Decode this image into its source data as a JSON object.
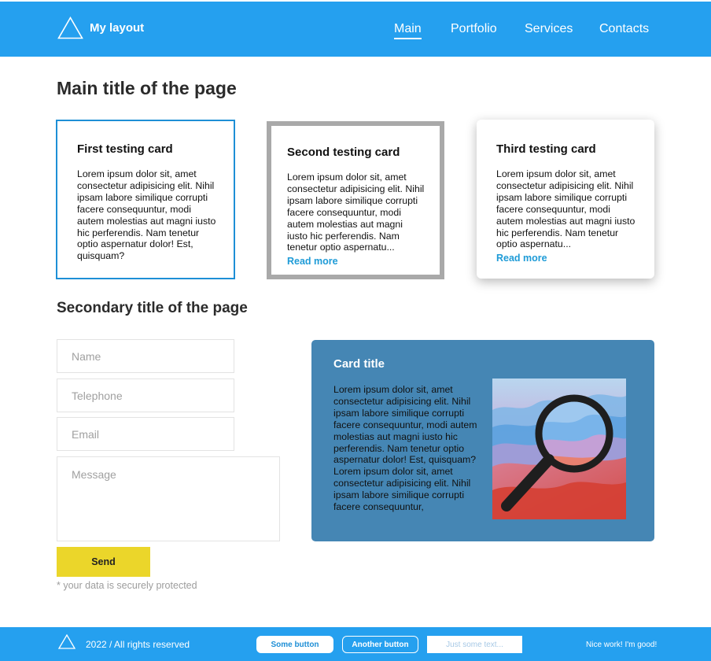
{
  "header": {
    "logo_text": "My layout",
    "nav": [
      "Main",
      "Portfolio",
      "Services",
      "Contacts"
    ],
    "active_nav": "Main"
  },
  "main_title": "Main title of the page",
  "cards": [
    {
      "title": "First testing card",
      "text": "Lorem ipsum dolor sit, amet consectetur adipisicing elit. Nihil ipsam labore similique corrupti facere consequuntur, modi autem molestias aut magni iusto hic perferendis. Nam tenetur optio aspernatur dolor! Est, quisquam?"
    },
    {
      "title": "Second testing card",
      "text": "Lorem ipsum dolor sit, amet consectetur adipisicing elit. Nihil ipsam labore similique corrupti facere consequuntur, modi autem molestias aut magni iusto hic perferendis. Nam tenetur optio aspernatu...",
      "link": "Read more"
    },
    {
      "title": "Third testing card",
      "text": "Lorem ipsum dolor sit, amet consectetur adipisicing elit. Nihil ipsam labore similique corrupti facere consequuntur, modi autem molestias aut magni iusto hic perferendis. Nam tenetur optio aspernatu...",
      "link": "Read more"
    }
  ],
  "secondary_title": "Secondary title of the page",
  "form": {
    "name_placeholder": "Name",
    "telephone_placeholder": "Telephone",
    "email_placeholder": "Email",
    "message_placeholder": "Message",
    "send_label": "Send",
    "note": "* your data is securely protected"
  },
  "feature_card": {
    "title": "Card title",
    "text": "Lorem ipsum dolor sit, amet consectetur adipisicing elit. Nihil ipsam labore similique corrupti facere consequuntur, modi autem molestias aut magni iusto hic perferendis. Nam tenetur optio aspernatur dolor! Est, quisquam? Lorem ipsum dolor sit, amet consectetur adipisicing elit. Nihil ipsam labore similique corrupti facere consequuntur,",
    "image_icon": "magnifier-icon"
  },
  "footer": {
    "copyright": "2022 / All rights reserved",
    "button1": "Some button",
    "button2": "Another button",
    "input_placeholder": "Just some text...",
    "right_text": "Nice work! I'm good!"
  },
  "colors": {
    "primary": "#25a0ef",
    "card_border": "#1e8fd6",
    "grey_border": "#a9a9a9",
    "link": "#1e9bd7",
    "feature_bg": "#4586b4",
    "send_button": "#ebd62a"
  }
}
